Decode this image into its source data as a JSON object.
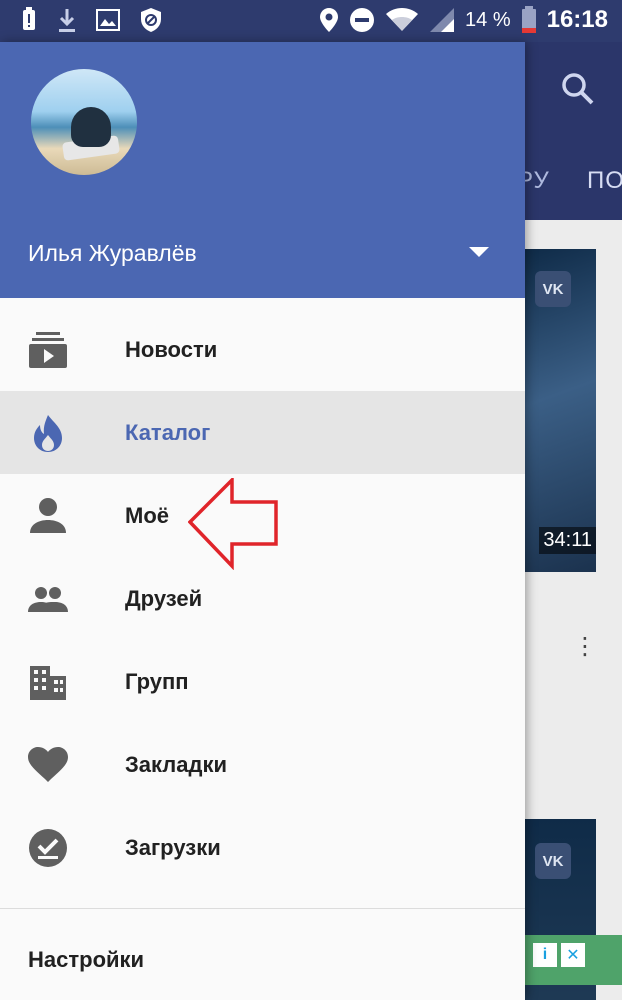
{
  "status_bar": {
    "battery_percent": "14 %",
    "time": "16:18",
    "icons": [
      "alert-battery-icon",
      "download-icon",
      "image-icon",
      "data-saver-icon",
      "location-icon",
      "do-not-disturb-icon",
      "wifi-icon",
      "signal-icon",
      "battery-icon"
    ]
  },
  "background_app": {
    "tab_partial_1": "РУ",
    "tab_partial_2": "ПО",
    "thumb1_badge": "VK",
    "thumb1_duration": "34:11",
    "thumb2_badge": "VK",
    "ad_info": "i",
    "ad_close": "✕"
  },
  "drawer": {
    "user_name": "Илья Журавлёв",
    "items": [
      {
        "label": "Новости",
        "icon": "news-icon"
      },
      {
        "label": "Каталог",
        "icon": "flame-icon",
        "active": true
      },
      {
        "label": "Моё",
        "icon": "person-icon"
      },
      {
        "label": "Друзей",
        "icon": "people-icon"
      },
      {
        "label": "Групп",
        "icon": "building-icon"
      },
      {
        "label": "Закладки",
        "icon": "heart-icon"
      },
      {
        "label": "Загрузки",
        "icon": "download-done-icon"
      }
    ],
    "settings_label": "Настройки"
  },
  "colors": {
    "header": "#4b67b2",
    "status_bar": "#2e3b6e",
    "active_item": "#4b67b2",
    "annotation_arrow": "#e0242a"
  }
}
